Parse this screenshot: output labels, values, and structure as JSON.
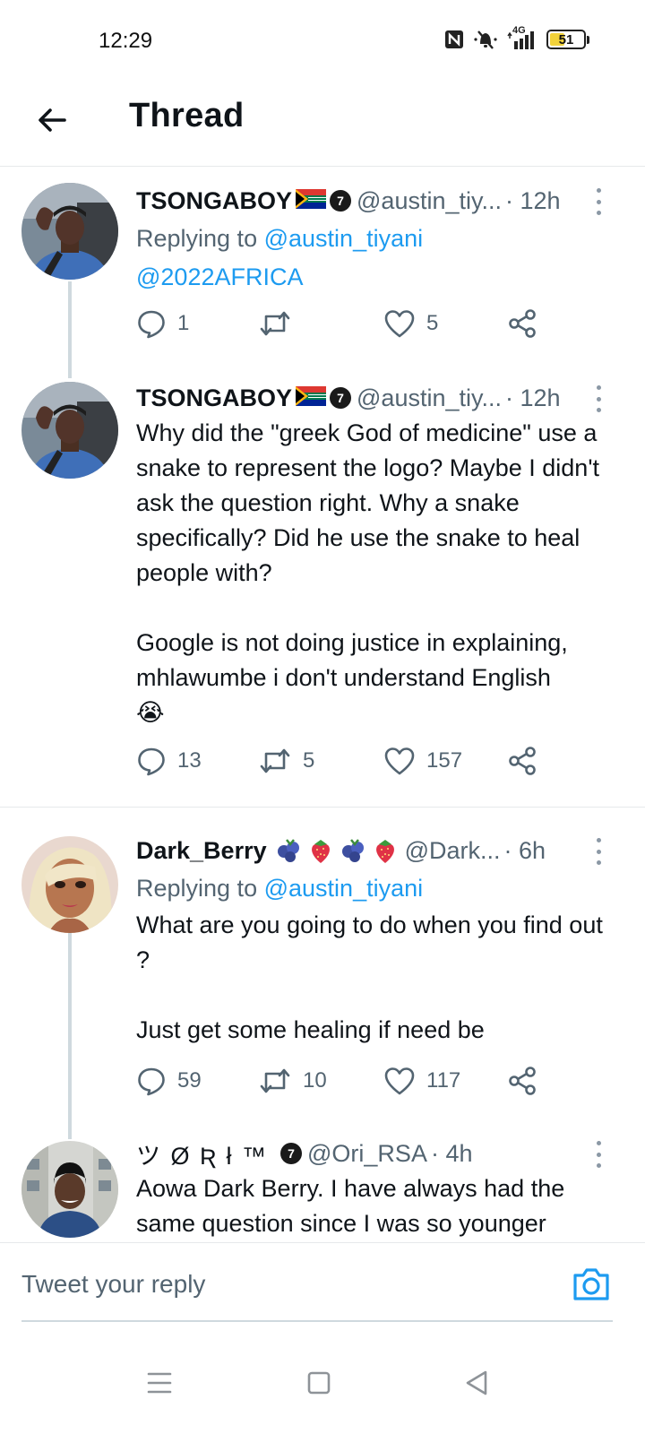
{
  "status_bar": {
    "time": "12:29",
    "network": "4G",
    "battery": "51",
    "battery_level": 0.51
  },
  "header": {
    "title": "Thread"
  },
  "tweets": [
    {
      "name": "TSONGABOY",
      "verified_badge": "7",
      "handle": "@austin_tiy...",
      "time": "· 12h",
      "reply_prefix": "Replying to",
      "reply_to": "@austin_tiyani",
      "text_link": "@2022AFRICA",
      "replies": "1",
      "retweets": "",
      "likes": "5"
    },
    {
      "name": "TSONGABOY",
      "verified_badge": "7",
      "handle": "@austin_tiy...",
      "time": "· 12h",
      "text": "Why did the \"greek God of medicine\" use a snake to represent the logo? Maybe I didn't ask the question right. Why a snake specifically? Did he use the snake to heal people with?\n\nGoogle is not doing justice in explaining, mhlawumbe i don't understand English",
      "emoji": "😭",
      "replies": "13",
      "retweets": "5",
      "likes": "157"
    },
    {
      "name": "Dark_Berry",
      "handle": "@Dark...",
      "time": "· 6h",
      "reply_prefix": "Replying to",
      "reply_to": "@austin_tiyani",
      "text": "What are you going to do when you find out ?\n\nJust get some healing if need be",
      "replies": "59",
      "retweets": "10",
      "likes": "117"
    },
    {
      "name": "ツ Ø Ʀ ł ™",
      "verified_badge": "7",
      "handle": "@Ori_RSA",
      "time": "· 4h",
      "text": "Aowa Dark Berry. I have always had the same question since I was so younger"
    }
  ],
  "reply_bar": {
    "placeholder": "Tweet your reply"
  },
  "icons": {
    "back": "arrow-left-icon",
    "more": "more-vertical-icon",
    "reply": "comment-icon",
    "retweet": "retweet-icon",
    "like": "heart-icon",
    "share": "share-icon",
    "camera": "camera-icon"
  },
  "colors": {
    "link": "#1d9bf0",
    "secondary_text": "#536471",
    "thread_line": "#cfd9de",
    "battery": "#f2d23a"
  }
}
